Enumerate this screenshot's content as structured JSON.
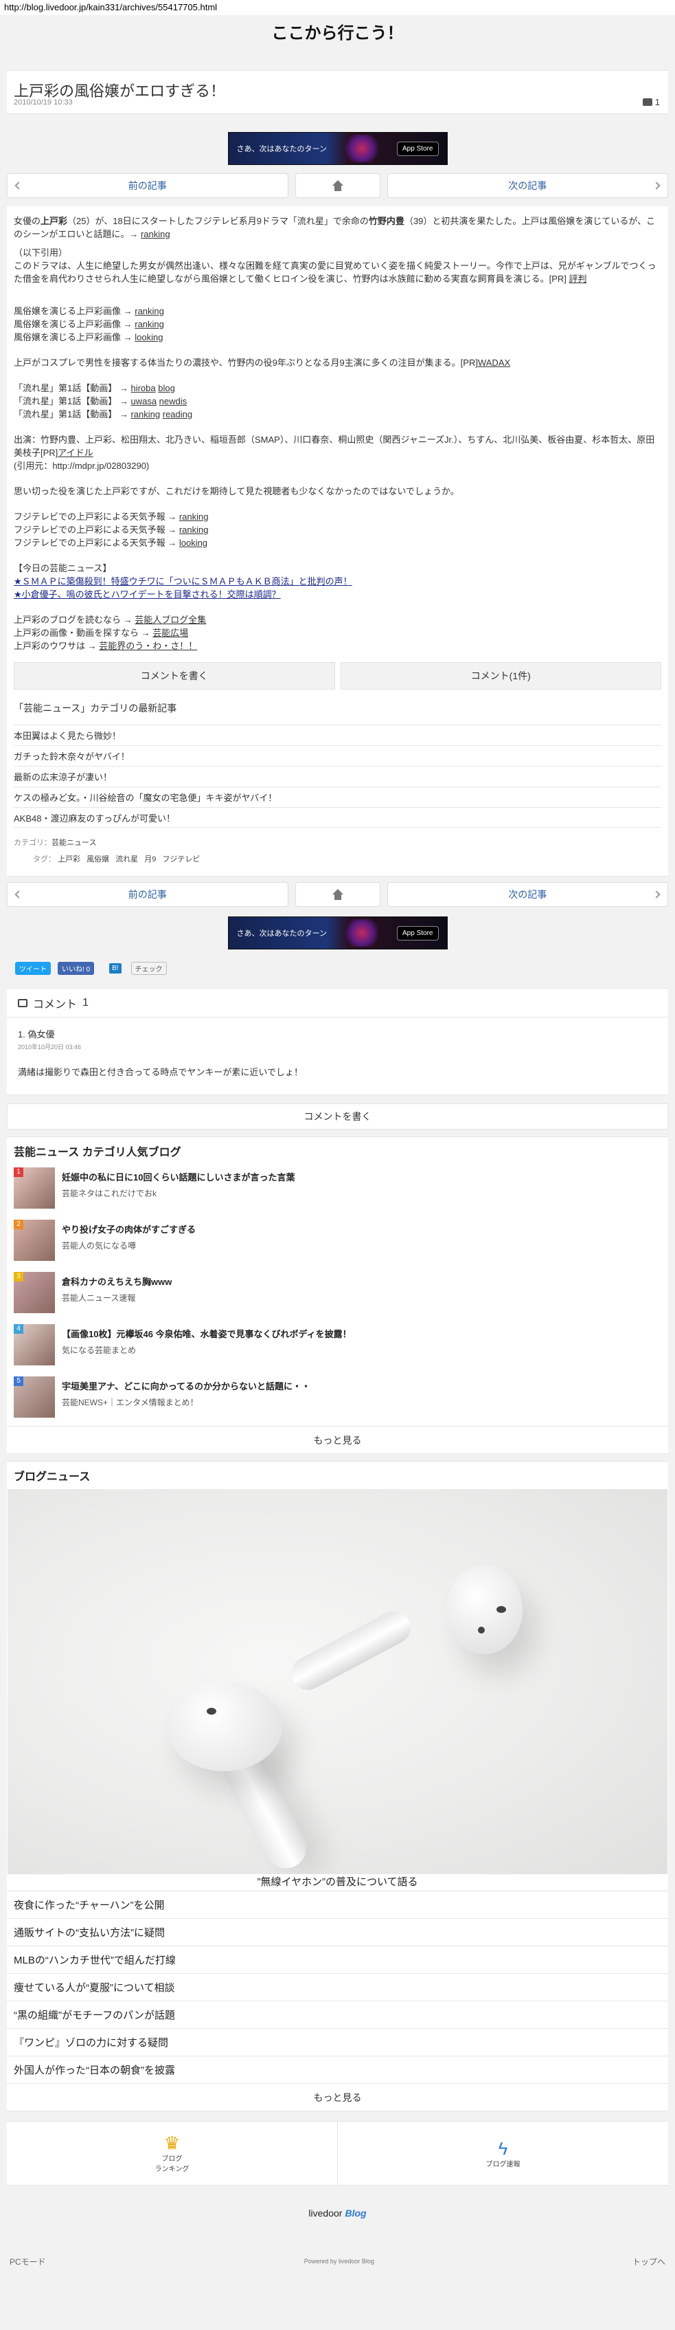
{
  "url": "http://blog.livedoor.jp/kain331/archives/55417705.html",
  "site_title": "ここから行こう！",
  "post": {
    "title": "上戸彩の風俗嬢がエロすぎる！",
    "date": "2010/10/19 10:33",
    "comment_count": "1"
  },
  "banner": {
    "text": "さあ、次はあなたのターン",
    "store": " App Store"
  },
  "pager": {
    "prev": "前の記事",
    "next": "次の記事"
  },
  "article": {
    "p1a": "女優の",
    "p1b": "上戸彩",
    "p1c": "（25）が、18日にスタートしたフジテレビ系月9ドラマ「流れ星」で余命の",
    "p1d": "竹野内豊",
    "p1e": "（39）と初共演を果たした。上戸は風俗嬢を演じているが、このシーンがエロいと話題に。→ ",
    "ranking": "ranking",
    "quote_head": "（以下引用）",
    "quote": "このドラマは、人生に絶望した男女が偶然出逢い、様々な困難を経て真実の愛に目覚めていく姿を描く純愛ストーリー。今作で上戸は、兄がギャンブルでつくった借金を肩代わりさせられ人生に絶望しながら風俗嬢として働くヒロイン役を演じ、竹野内は水族館に勤める実直な飼育員を演じる。[PR] ",
    "quote_link": "評判",
    "img1": "風俗嬢を演じる上戸彩画像 → ",
    "img2": "風俗嬢を演じる上戸彩画像 → ",
    "img3": "風俗嬢を演じる上戸彩画像 → ",
    "looking": "looking",
    "p2": "上戸がコスプレで男性を接客する体当たりの濃技や、竹野内の役9年ぶりとなる月9主演に多くの注目が集まる。[PR]",
    "p2_link": "WADAX",
    "v1": "「流れ星」第1話【動画】 → ",
    "v1a": "hiroba",
    "v1b": "blog",
    "v2": "「流れ星」第1話【動画】 → ",
    "v2a": "uwasa",
    "v2b": "newdis",
    "v3": "「流れ星」第1話【動画】 → ",
    "v3b": "reading",
    "cast": "出演：竹野内豊、上戸彩、松田翔太、北乃きい、稲垣吾郎（SMAP）、川口春奈、桐山照史（関西ジャニーズJr.）、ちすん、北川弘美、板谷由夏、杉本哲太、原田美枝子[PR]",
    "cast_link": "アイドル",
    "source": "(引用元：http://mdpr.jp/02803290)",
    "p3": "思い切った役を演じた上戸彩ですが、これだけを期待して見た視聴者も少なくなかったのではないでしょうか。",
    "w1": "フジテレビでの上戸彩による天気予報 → ",
    "w2": "フジテレビでの上戸彩による天気予報 → ",
    "w3": "フジテレビでの上戸彩による天気予報 → ",
    "today_head": "【今日の芸能ニュース】",
    "today1": "★ＳＭＡＰに築傷殺到！特盛ウチワに「ついにＳＭＡＰもＡＫＢ商法」と批判の声！",
    "today2": "★小倉優子、嗚の彼氏とハワイデートを目撃される！交際は順調？",
    "l1": "上戸彩のブログを読むなら → ",
    "l1_link": "芸能人ブログ全集",
    "l2": "上戸彩の画像・動画を探すなら → ",
    "l2_link": "芸能広場",
    "l3": "上戸彩のウワサは → ",
    "l3_link": "芸能界のう・わ・さ！！"
  },
  "buttons": {
    "write": "コメントを書く",
    "comment": "コメント(1件)"
  },
  "category": {
    "title": "「芸能ニュース」カテゴリの最新記事",
    "items": [
      "本田翼はよく見たら微妙！",
      "ガチった鈴木奈々がヤバイ！",
      "最新の広末涼子が凄い！",
      "ケスの極みど女。・川谷絵音の「魔女の宅急便」キキ姿がヤバイ！",
      "AKB48・渡辺麻友のすっぴんが可愛い！"
    ],
    "cat_label": "カテゴリ：",
    "cat_value": "芸能ニュース",
    "tag_label": "タグ：",
    "tags": [
      "上戸彩",
      "風俗嬢",
      "流れ星",
      "月9",
      "フジテレビ"
    ]
  },
  "social": {
    "tweet": "ツイート",
    "like": "いいね! 0",
    "like_count": "0",
    "check": "チェック"
  },
  "comments": {
    "heading": "コメント",
    "count": "1",
    "items": [
      {
        "name": "1. 偽女優",
        "date": "2010年10月20日 03:46",
        "body": "満緒は撮影りで森田と付き合ってる時点でヤンキーが素に近いでしょ！"
      }
    ],
    "write": "コメントを書く"
  },
  "ranking": {
    "title": "芸能ニュース カテゴリ人気ブログ",
    "items": [
      {
        "rank": "1",
        "title": "妊娠中の私に日に10回くらい話題にしいさまが言った言葉",
        "blog": "芸能ネタはこれだけでおk",
        "color": "#e43c3c"
      },
      {
        "rank": "2",
        "title": "やり投げ女子の肉体がすごすぎる",
        "blog": "芸能人の気になる噂",
        "color": "#f08a24"
      },
      {
        "rank": "3",
        "title": "倉科カナのえちえち胸www",
        "blog": "芸能人ニュース速報",
        "color": "#e8b800"
      },
      {
        "rank": "4",
        "title": "【画像10枚】元欅坂46 今泉佑唯、水着姿で見事なくびれボディを披露！",
        "blog": "気になる芸能まとめ",
        "color": "#3da3d9"
      },
      {
        "rank": "5",
        "title": "宇垣美里アナ、どこに向かってるのか分からないと話題に・・",
        "blog": "芸能NEWS+｜エンタメ情報まとめ！",
        "color": "#3d76d9"
      }
    ],
    "more": "もっと見る"
  },
  "news": {
    "title": "ブログニュース",
    "hero_caption": "”無線イヤホン”の普及について語る",
    "items": [
      "夜食に作った“チャーハン”を公開",
      "通販サイトの“支払い方法”に疑問",
      "MLBの“ハンカチ世代”で組んだ打線",
      "痩せている人が“夏服”について相談",
      "“黒の組織”がモチーフのパンが話題",
      "『ワンピ』ゾロの力に対する疑問",
      "外国人が作った“日本の朝食”を披露"
    ],
    "more": "もっと見る"
  },
  "bottom_nav": {
    "ranking": "ブログ\nランキング",
    "ranking_l1": "ブログ",
    "ranking_l2": "ランキング",
    "quick": "ブログ速報"
  },
  "logo": {
    "brand": "livedoor",
    "blog": "Blog"
  },
  "footer": {
    "left": "PCモード",
    "mid": "Powered by livedoor Blog",
    "right": "トップへ"
  }
}
